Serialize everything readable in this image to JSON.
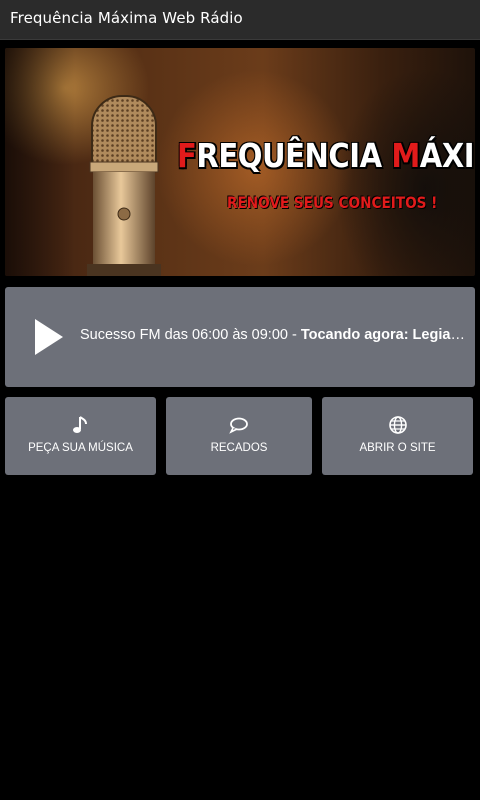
{
  "app": {
    "title": "Frequência Máxima Web Rádio"
  },
  "banner": {
    "brand_part1": "F",
    "brand_part2": "REQUÊNCIA ",
    "brand_part3": "M",
    "brand_part4": "ÁXIMA",
    "slogan": "RENOVE SEUS CONCEITOS !"
  },
  "player": {
    "program": "Sucesso FM das 06:00 às 09:00 - ",
    "now_playing_label": "Tocando agora: Legiao…",
    "icon": "play-icon"
  },
  "actions": [
    {
      "label": "PEÇA SUA MÚSICA",
      "icon": "music-note-icon"
    },
    {
      "label": "RECADOS",
      "icon": "speech-bubble-icon"
    },
    {
      "label": "ABRIR O SITE",
      "icon": "globe-icon"
    }
  ],
  "colors": {
    "background": "#000000",
    "titlebar": "#2b2b2b",
    "card": "#6d7079",
    "brand_red": "#e11b1b"
  }
}
